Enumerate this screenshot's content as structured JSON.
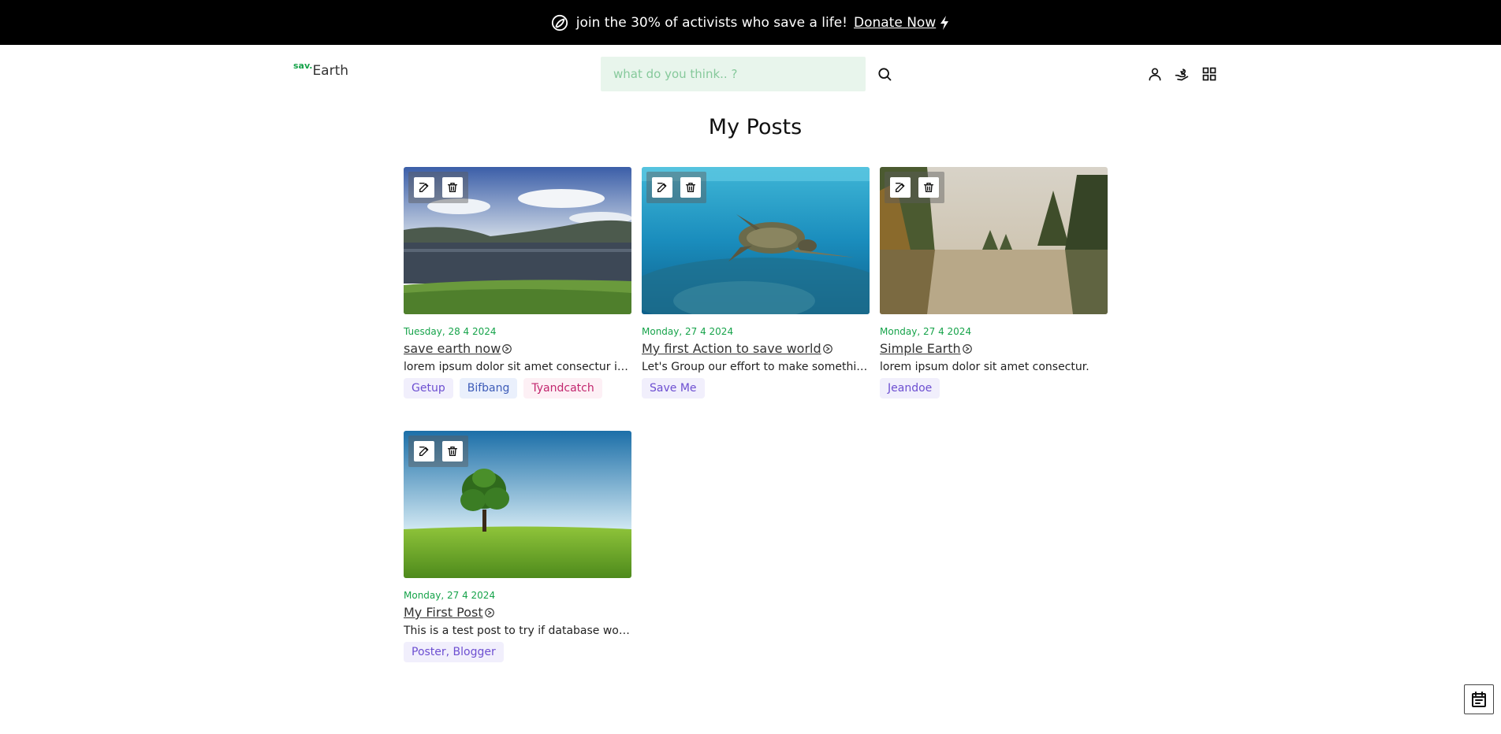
{
  "banner": {
    "text": "join the 30% of activists who save a life!",
    "link_label": "Donate Now"
  },
  "logo": {
    "prefix": "sav.",
    "name": "Earth"
  },
  "search": {
    "placeholder": "what do you think.. ?"
  },
  "page_title": "My Posts",
  "posts": [
    {
      "date": "Tuesday, 28 4 2024",
      "title": "save earth now",
      "description": "lorem ipsum dolor sit amet consectur im ipsum dolor",
      "tags": [
        "Getup",
        "Bifbang",
        "Tyandcatch"
      ],
      "image": "lake-hills"
    },
    {
      "date": "Monday, 27 4 2024",
      "title": "My first Action to save world",
      "description": "Let's Group our effort to make something great together",
      "tags": [
        "Save Me"
      ],
      "image": "sea-turtle"
    },
    {
      "date": "Monday, 27 4 2024",
      "title": "Simple Earth",
      "description": "lorem ipsum dolor sit amet consectur.",
      "tags": [
        "Jeandoe"
      ],
      "image": "misty-lake-forest"
    },
    {
      "date": "Monday, 27 4 2024",
      "title": "My First Post",
      "description": "This is a test post to try if database works",
      "tags": [
        "Poster, Blogger"
      ],
      "image": "lone-tree-field"
    }
  ],
  "colors": {
    "accent": "#16a34a",
    "banner_bg": "#000000",
    "search_bg": "#e8f5ec"
  }
}
